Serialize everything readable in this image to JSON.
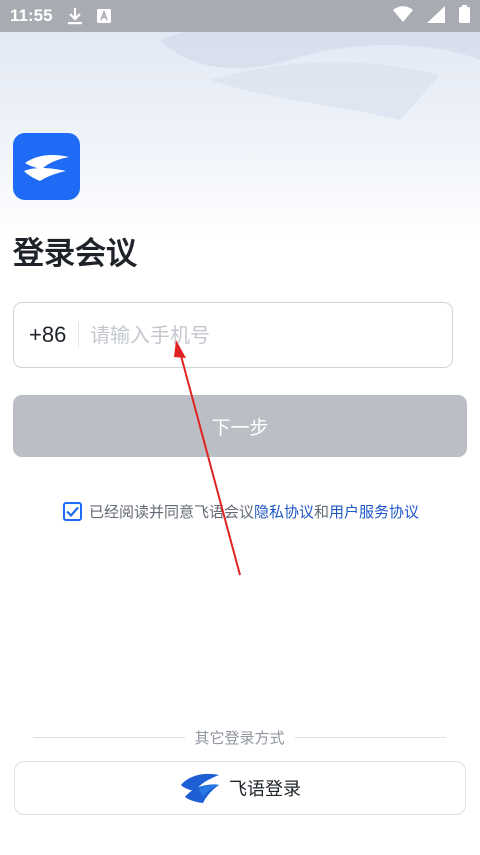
{
  "status_bar": {
    "time": "11:55",
    "icons_left": [
      "download-icon",
      "a-badge-icon"
    ],
    "icons_right": [
      "wifi-icon",
      "signal-icon",
      "battery-icon"
    ]
  },
  "app": {
    "logo_icon": "feiyu-meeting-logo-icon",
    "brand_color": "#1f6bf5"
  },
  "page": {
    "title": "登录会议"
  },
  "phone": {
    "country_code": "+86",
    "value": "",
    "placeholder": "请输入手机号"
  },
  "next_button": {
    "label": "下一步"
  },
  "agreement": {
    "checked": true,
    "prefix": "已经阅读并同意飞语会议",
    "privacy_link": "隐私协议",
    "and": "和",
    "service_link": "用户服务协议"
  },
  "other_login": {
    "section_title": "其它登录方式",
    "feishu_button_label": "飞语登录",
    "feishu_icon": "feiyu-wing-icon"
  },
  "annotation": {
    "arrow_color": "#e02424"
  }
}
